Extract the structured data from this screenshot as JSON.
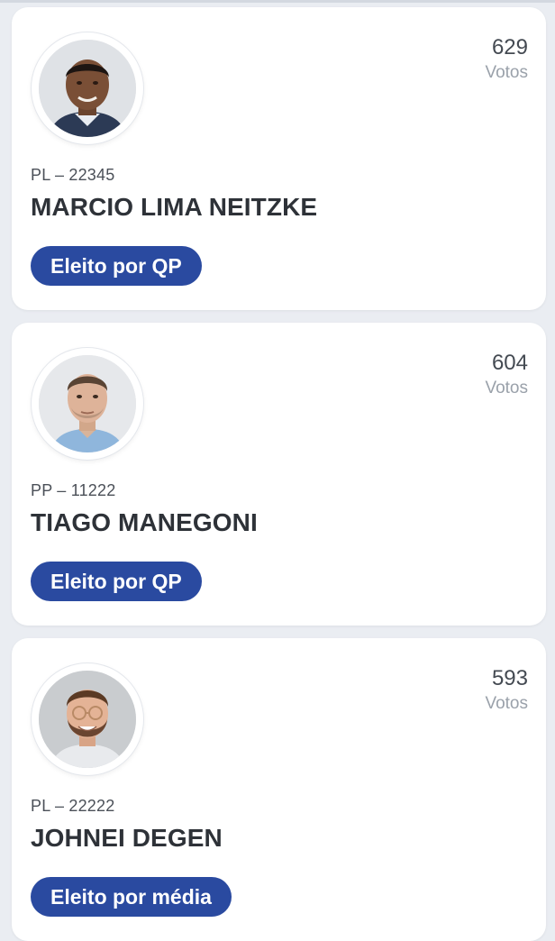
{
  "candidates": [
    {
      "votes": "629",
      "votes_label": "Votos",
      "party": "PL – 22345",
      "name": "MARCIO LIMA NEITZKE",
      "status": "Eleito por QP"
    },
    {
      "votes": "604",
      "votes_label": "Votos",
      "party": "PP – 11222",
      "name": "TIAGO MANEGONI",
      "status": "Eleito por QP"
    },
    {
      "votes": "593",
      "votes_label": "Votos",
      "party": "PL – 22222",
      "name": "JOHNEI DEGEN",
      "status": "Eleito por média"
    }
  ],
  "colors": {
    "badge": "#2a4aa0",
    "background": "#eaedf2",
    "card": "#ffffff"
  }
}
